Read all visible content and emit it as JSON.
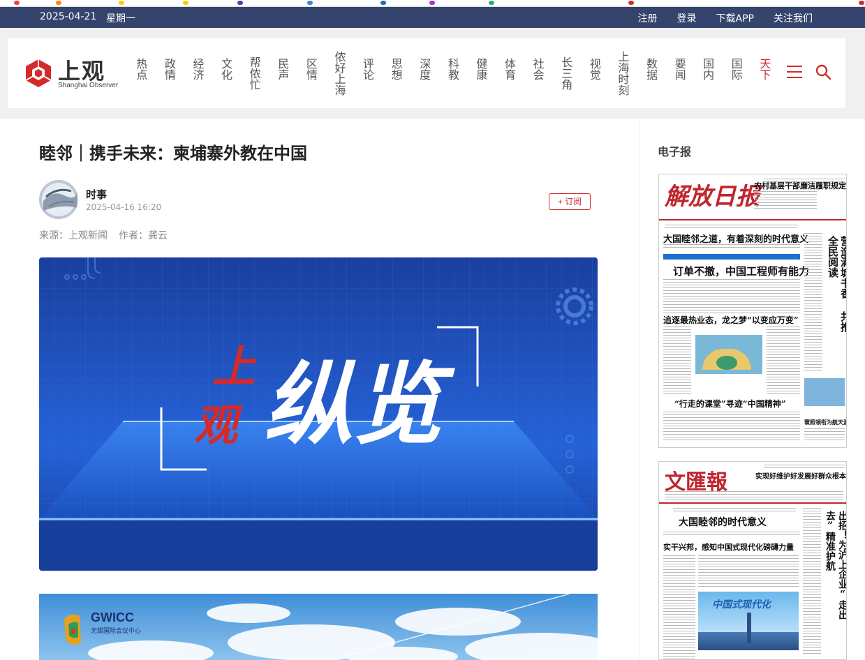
{
  "topbar": {
    "date": "2025-04-21",
    "weekday": "星期一",
    "links": [
      "注册",
      "登录",
      "下载APP",
      "关注我们"
    ]
  },
  "logo": {
    "name": "上观",
    "english": "Shanghai Observer"
  },
  "nav": {
    "items": [
      "热点",
      "政情",
      "经济",
      "文化",
      "帮侬忙",
      "民声",
      "区情",
      "侬好上海",
      "评论",
      "思想",
      "深度",
      "科教",
      "健康",
      "体育",
      "社会",
      "长三角",
      "视觉",
      "上海时刻",
      "数据",
      "要闻",
      "国内",
      "国际",
      "天下"
    ],
    "active_index": 22
  },
  "article": {
    "title": "睦邻｜携手未来：柬埔寨外教在中国",
    "author": "时事",
    "publish_time": "2025-04-16 16:20",
    "subscribe_label": "+ 订阅",
    "source": "来源：上观新闻",
    "writer": "作者：龚云",
    "hero_text_small": [
      "上",
      "观"
    ],
    "hero_text_big": "纵览",
    "second_img_logo": "GWICC",
    "second_img_logo_sub": "无锡国际会议中心"
  },
  "sidebar": {
    "title": "电子报",
    "paper1": {
      "masthead": "解放日报",
      "top_headline": "农村基层干部廉洁履职规定发布",
      "headline1": "大国睦邻之道，有着深刻的时代意义",
      "headline2": "订单不撤，中国工程师有能力",
      "headline3": "追逐最热业态，龙之梦“以变应万变”",
      "headline4": "“行走的课堂”寻迹“中国精神”",
      "side_headline": "营造满城书香 共推全民阅读",
      "side_small": "寰照领衔为航天源 铸造超级心脏"
    },
    "paper2": {
      "masthead": "文匯報",
      "top_headline": "实现好维护好发展好群众根本利益",
      "headline1": "大国睦邻的时代意义",
      "headline2": "实干兴邦，感知中国式现代化磅礴力量",
      "side_headline": "出招！为沪上企业“走出去”精准护航",
      "image_caption": "中国式现代化"
    }
  },
  "colors": {
    "topbar_bg": "#34446d",
    "accent_red": "#d42a2a",
    "hero_blue": "#1f56c8"
  }
}
